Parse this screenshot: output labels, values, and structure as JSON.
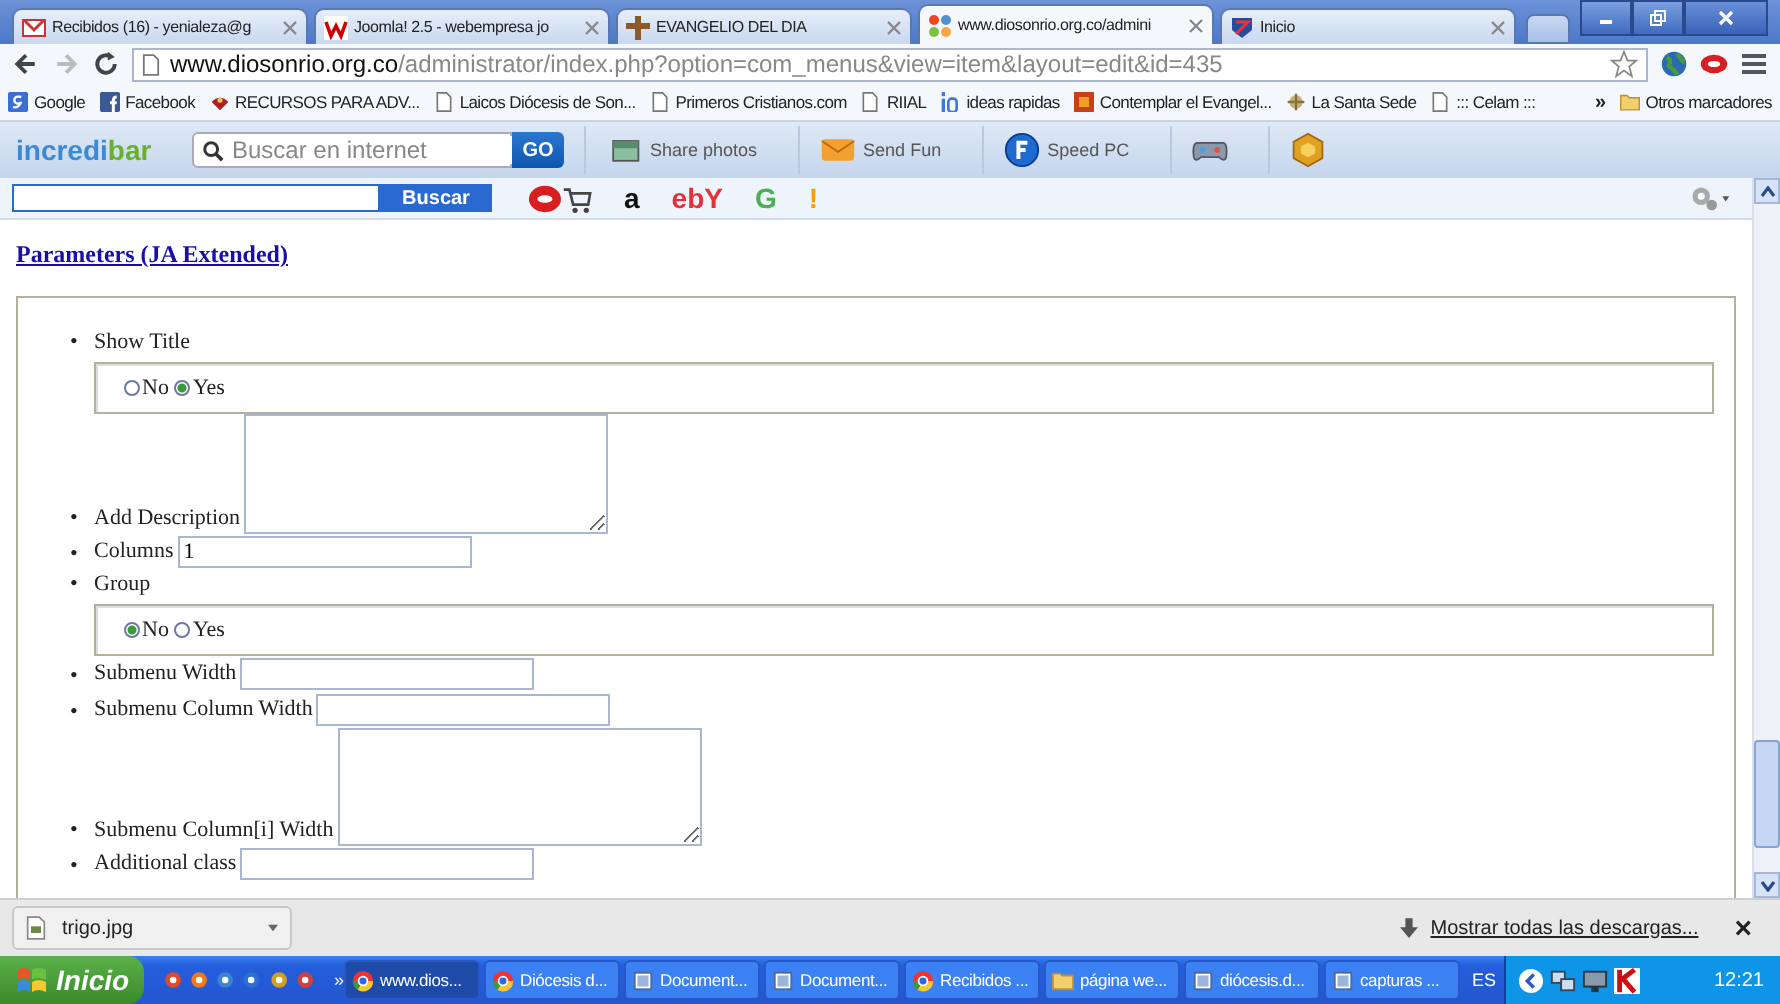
{
  "tabs": [
    {
      "title": "Recibidos (16) - yenialeza@g",
      "selected": false
    },
    {
      "title": "Joomla! 2.5 - webempresa jo",
      "selected": false
    },
    {
      "title": "EVANGELIO DEL DIA",
      "selected": false
    },
    {
      "title": "www.diosonrio.org.co/admini",
      "selected": true
    },
    {
      "title": "Inicio",
      "selected": false
    }
  ],
  "address_bar": {
    "host": "www.diosonrio.org.co",
    "path": "/administrator/index.php?option=com_menus&view=item&layout=edit&id=435"
  },
  "bookmarks": [
    {
      "label": "Google"
    },
    {
      "label": "Facebook"
    },
    {
      "label": "RECURSOS PARA ADV..."
    },
    {
      "label": "Laicos Diócesis de Son..."
    },
    {
      "label": "Primeros Cristianos.com"
    },
    {
      "label": "RIIAL"
    },
    {
      "label": "ideas rapidas"
    },
    {
      "label": "Contemplar el Evangel..."
    },
    {
      "label": "La Santa Sede"
    },
    {
      "label": "::: Celam :::"
    }
  ],
  "bookmarks_more": "»",
  "other_bookmarks": "Otros marcadores",
  "toolbar": {
    "logo_main": "incredi",
    "logo_accent": "bar",
    "search_placeholder": "Buscar en internet",
    "go": "GO",
    "items": [
      {
        "label": "Share photos"
      },
      {
        "label": "Send Fun"
      },
      {
        "label": "Speed PC"
      }
    ]
  },
  "search_toolbar": {
    "button": "Buscar",
    "shortcuts": [
      {
        "label": "a",
        "color": "#111111"
      },
      {
        "label": "ebY",
        "color": "#e53238"
      },
      {
        "label": "G",
        "color": "#4caf50"
      },
      {
        "label": "!",
        "color": "#f5a000"
      }
    ]
  },
  "page": {
    "heading": "Parameters (JA Extended)",
    "fields": [
      {
        "kind": "radio",
        "marker": "•",
        "label": "Show Title",
        "options": [
          {
            "label": "No",
            "selected": false
          },
          {
            "label": "Yes",
            "selected": true
          }
        ]
      },
      {
        "kind": "textarea",
        "marker": "•",
        "label": "Add Description"
      },
      {
        "kind": "text",
        "marker": "•",
        "label": "Columns",
        "value": "1"
      },
      {
        "kind": "radio",
        "marker": "•",
        "label": "Group",
        "options": [
          {
            "label": "No",
            "selected": true
          },
          {
            "label": "Yes",
            "selected": false
          }
        ]
      },
      {
        "kind": "text",
        "marker": "•",
        "label": "Submenu Width"
      },
      {
        "kind": "text",
        "marker": "•",
        "label": "Submenu Column Width"
      },
      {
        "kind": "textarea",
        "marker": "•",
        "label": "Submenu Column[i] Width"
      },
      {
        "kind": "text",
        "marker": "•",
        "label": "Additional class"
      }
    ]
  },
  "downloads": {
    "file": "trigo.jpg",
    "show_all": "Mostrar todas las descargas...",
    "close": "×"
  },
  "taskbar": {
    "start": "Inicio",
    "more": "»",
    "tasks": [
      {
        "label": "www.dios...",
        "selected": true
      },
      {
        "label": "Diócesis d...",
        "selected": false
      },
      {
        "label": "Document...",
        "selected": false
      },
      {
        "label": "Document...",
        "selected": false
      },
      {
        "label": "Recibidos ...",
        "selected": false
      },
      {
        "label": "página we...",
        "selected": false
      },
      {
        "label": "diócesis.d...",
        "selected": false
      },
      {
        "label": "capturas ...",
        "selected": false
      }
    ],
    "language": "ES",
    "clock": "12:21"
  }
}
